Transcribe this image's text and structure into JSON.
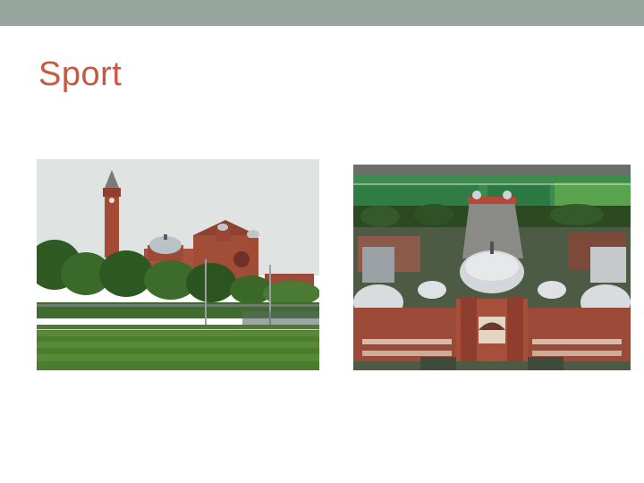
{
  "slide": {
    "title": "Sport",
    "accent_band_color": "#96a59b",
    "title_color": "#c8583f"
  },
  "images": [
    {
      "name": "campus-clock-tower-playing-field-photo"
    },
    {
      "name": "aerial-great-hall-sports-pitches-photo"
    }
  ]
}
